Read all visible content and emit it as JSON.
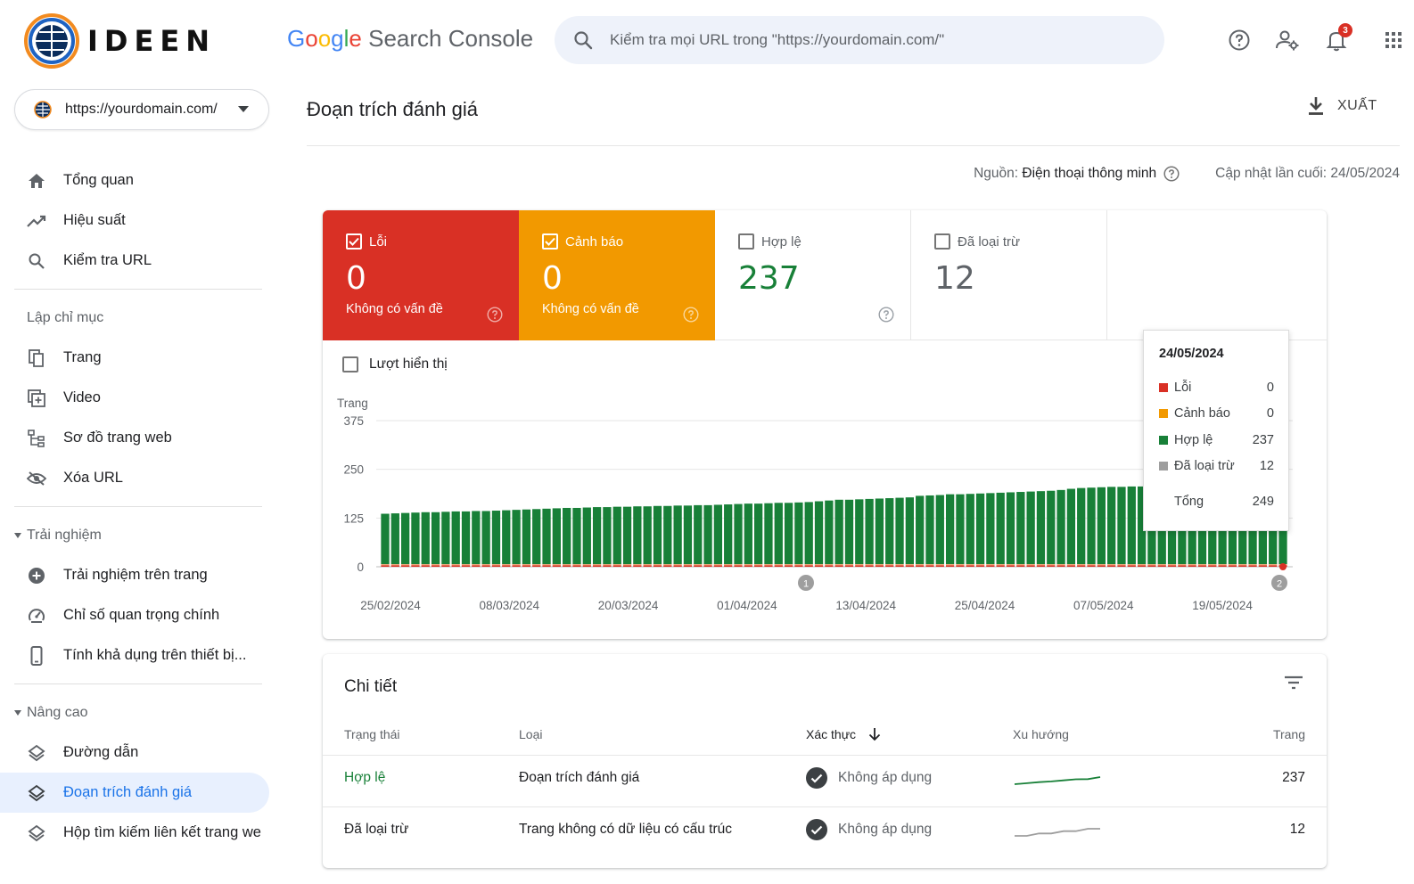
{
  "brand": {
    "logo_text": "IDEEN",
    "product_title": "Search Console"
  },
  "search": {
    "placeholder": "Kiểm tra mọi URL trong \"https://yourdomain.com/\""
  },
  "header_icons": {
    "notification_count": "3"
  },
  "property": {
    "url": "https://yourdomain.com/"
  },
  "sidebar": {
    "items": [
      {
        "label": "Tổng quan",
        "icon": "home-icon"
      },
      {
        "label": "Hiệu suất",
        "icon": "trending-up-icon"
      },
      {
        "label": "Kiểm tra URL",
        "icon": "search-icon"
      }
    ],
    "indexing": {
      "heading": "Lập chỉ mục",
      "items": [
        {
          "label": "Trang",
          "icon": "pages-icon"
        },
        {
          "label": "Video",
          "icon": "video-icon"
        },
        {
          "label": "Sơ đồ trang web",
          "icon": "sitemap-icon"
        },
        {
          "label": "Xóa URL",
          "icon": "hidden-eye-icon"
        }
      ]
    },
    "experience": {
      "heading": "Trải nghiệm",
      "items": [
        {
          "label": "Trải nghiệm trên trang",
          "icon": "plus-circle-icon"
        },
        {
          "label": "Chỉ số quan trọng chính",
          "icon": "speed-icon"
        },
        {
          "label": "Tính khả dụng trên thiết bị...",
          "icon": "phone-icon"
        }
      ]
    },
    "enhancements": {
      "heading": "Nâng cao",
      "items": [
        {
          "label": "Đường dẫn",
          "icon": "layers-icon"
        },
        {
          "label": "Đoạn trích đánh giá",
          "icon": "layers-icon",
          "active": true
        },
        {
          "label": "Hộp tìm kiếm liên kết trang we",
          "icon": "layers-icon"
        }
      ]
    }
  },
  "page": {
    "title": "Đoạn trích đánh giá",
    "export_label": "XUẤT",
    "source_label": "Nguồn:",
    "source_value": "Điện thoại thông minh",
    "updated_label": "Cập nhật lần cuối: 24/05/2024"
  },
  "tiles": [
    {
      "label": "Lỗi",
      "value": "0",
      "sub": "Không có vấn đề",
      "checked": true,
      "color": "#d93025"
    },
    {
      "label": "Cảnh báo",
      "value": "0",
      "sub": "Không có vấn đề",
      "checked": true,
      "color": "#f29900"
    },
    {
      "label": "Hợp lệ",
      "value": "237",
      "sub": "",
      "checked": false,
      "color": "#188038"
    },
    {
      "label": "Đã loại trừ",
      "value": "12",
      "sub": "",
      "checked": false,
      "color": "#9e9e9e"
    }
  ],
  "impressions_label": "Lượt hiển thị",
  "chart_data": {
    "type": "bar",
    "stacked": true,
    "ylabel": "Trang",
    "ylim": [
      0,
      375
    ],
    "yticks": [
      0,
      125,
      250,
      375
    ],
    "x_tick_labels": [
      "25/02/2024",
      "08/03/2024",
      "20/03/2024",
      "01/04/2024",
      "13/04/2024",
      "25/04/2024",
      "07/05/2024",
      "19/05/2024"
    ],
    "start_date": "25/02/2024",
    "end_date": "24/05/2024",
    "series": [
      {
        "name": "Lỗi",
        "color": "#d93025",
        "values": [
          0
        ]
      },
      {
        "name": "Cảnh báo",
        "color": "#f29900",
        "values": [
          0
        ]
      },
      {
        "name": "Hợp lệ",
        "color": "#188038",
        "values": [
          136,
          137,
          138,
          139,
          140,
          140,
          141,
          142,
          142,
          143,
          143,
          144,
          145,
          146,
          147,
          148,
          149,
          150,
          151,
          151,
          152,
          153,
          153,
          154,
          154,
          155,
          155,
          156,
          156,
          157,
          157,
          158,
          158,
          159,
          160,
          161,
          162,
          162,
          163,
          164,
          164,
          165,
          166,
          168,
          170,
          172,
          172,
          173,
          174,
          175,
          176,
          177,
          178,
          182,
          183,
          184,
          186,
          186,
          187,
          188,
          189,
          190,
          191,
          192,
          193,
          194,
          195,
          197,
          200,
          202,
          203,
          204,
          205,
          205,
          206,
          206,
          206,
          207,
          207,
          207,
          208,
          208,
          208,
          208,
          208,
          208,
          208,
          208,
          208,
          237
        ]
      },
      {
        "name": "Đã loại trừ",
        "color": "#9e9e9e",
        "values": [
          12
        ]
      }
    ],
    "grid": true,
    "annotations": [
      "1",
      "2"
    ],
    "tooltip": {
      "date": "24/05/2024",
      "rows": [
        {
          "name": "Lỗi",
          "value": "0",
          "color": "#d93025"
        },
        {
          "name": "Cảnh báo",
          "value": "0",
          "color": "#f29900"
        },
        {
          "name": "Hợp lệ",
          "value": "237",
          "color": "#188038"
        },
        {
          "name": "Đã loại trừ",
          "value": "12",
          "color": "#9e9e9e"
        }
      ],
      "total_label": "Tổng",
      "total_value": "249"
    }
  },
  "details": {
    "title": "Chi tiết",
    "columns": [
      "Trạng thái",
      "Loại",
      "Xác thực",
      "Xu hướng",
      "Trang"
    ],
    "rows": [
      {
        "status": "Hợp lệ",
        "type": "Đoạn trích đánh giá",
        "validation": "Không áp dụng",
        "pages": "237",
        "trend_color": "#188038",
        "trend": [
          136,
          150,
          165,
          175,
          190,
          205,
          208,
          237
        ]
      },
      {
        "status": "Đã loại trừ",
        "type": "Trang không có dữ liệu có cấu trúc",
        "validation": "Không áp dụng",
        "pages": "12",
        "trend_color": "#9e9e9e",
        "trend": [
          9,
          9,
          10,
          10,
          11,
          11,
          12,
          12
        ]
      }
    ]
  }
}
